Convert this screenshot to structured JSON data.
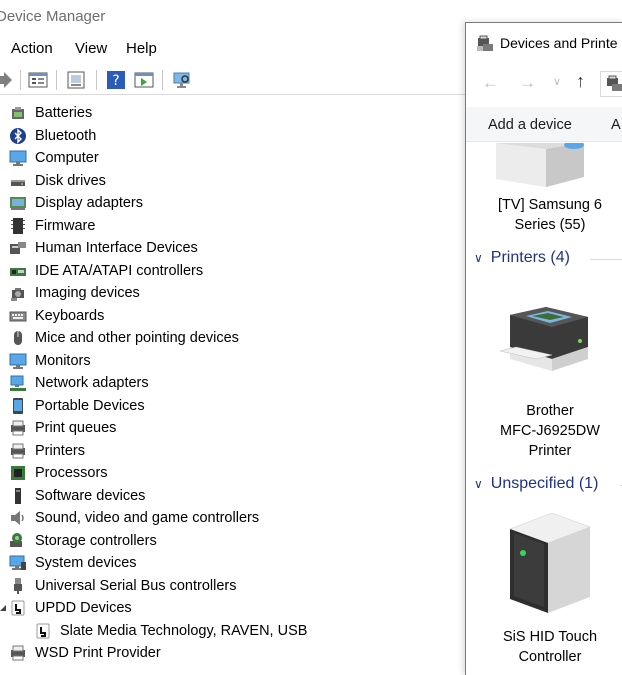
{
  "device_manager": {
    "title": "Device Manager",
    "menu": [
      "Action",
      "View",
      "Help"
    ],
    "tree": [
      {
        "label": "Batteries",
        "icon": "battery-icon"
      },
      {
        "label": "Bluetooth",
        "icon": "bluetooth-icon"
      },
      {
        "label": "Computer",
        "icon": "computer-icon"
      },
      {
        "label": "Disk drives",
        "icon": "disk-drive-icon"
      },
      {
        "label": "Display adapters",
        "icon": "display-adapter-icon"
      },
      {
        "label": "Firmware",
        "icon": "firmware-icon"
      },
      {
        "label": "Human Interface Devices",
        "icon": "hid-icon"
      },
      {
        "label": "IDE ATA/ATAPI controllers",
        "icon": "ide-controller-icon"
      },
      {
        "label": "Imaging devices",
        "icon": "imaging-device-icon"
      },
      {
        "label": "Keyboards",
        "icon": "keyboard-icon"
      },
      {
        "label": "Mice and other pointing devices",
        "icon": "mouse-icon"
      },
      {
        "label": "Monitors",
        "icon": "monitor-icon"
      },
      {
        "label": "Network adapters",
        "icon": "network-adapter-icon"
      },
      {
        "label": "Portable Devices",
        "icon": "portable-device-icon"
      },
      {
        "label": "Print queues",
        "icon": "print-queue-icon"
      },
      {
        "label": "Printers",
        "icon": "printer-icon"
      },
      {
        "label": "Processors",
        "icon": "processor-icon"
      },
      {
        "label": "Software devices",
        "icon": "software-device-icon"
      },
      {
        "label": "Sound, video and game controllers",
        "icon": "sound-icon"
      },
      {
        "label": "Storage controllers",
        "icon": "storage-controller-icon"
      },
      {
        "label": "System devices",
        "icon": "system-device-icon"
      },
      {
        "label": "Universal Serial Bus controllers",
        "icon": "usb-icon"
      },
      {
        "label": "UPDD Devices",
        "icon": "updd-icon",
        "expanded": true
      },
      {
        "label": "Slate Media Technology, RAVEN, USB",
        "icon": "updd-device-icon",
        "child": true
      },
      {
        "label": "WSD Print Provider",
        "icon": "wsd-print-icon"
      }
    ]
  },
  "devices_printers": {
    "title": "Devices and Printe",
    "command": {
      "add_device": "Add a device",
      "truncated": "A"
    },
    "items": [
      {
        "label_lines": [
          "[TV] Samsung 6",
          "Series (55)"
        ]
      }
    ],
    "groups": [
      {
        "label": "Printers (4)",
        "devices": [
          {
            "label_lines": [
              "Brother",
              "MFC-J6925DW",
              "Printer"
            ]
          }
        ]
      },
      {
        "label": "Unspecified (1)",
        "devices": [
          {
            "label_lines": [
              "SiS HID Touch",
              "Controller"
            ]
          }
        ]
      }
    ]
  },
  "colors": {
    "group_header": "#1e3287",
    "accent_blue": "#2d7fd3"
  }
}
